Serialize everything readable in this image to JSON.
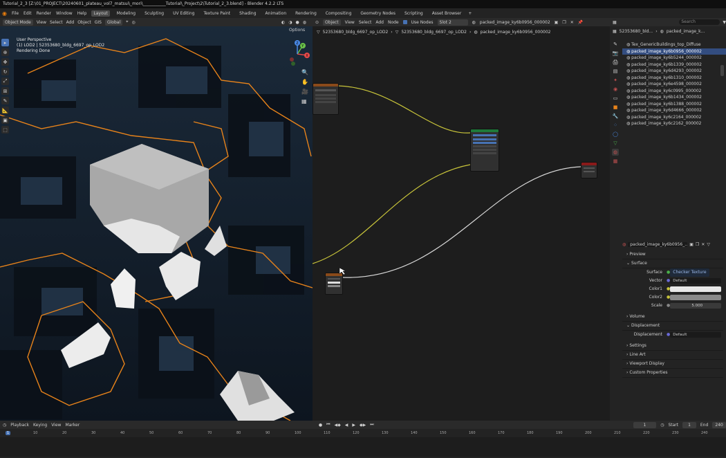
{
  "window": {
    "title": "Tutorial_2_3 [Z:\\01_PROJECT\\20240601_plateau_vol7_matsui\\_mori\\___________Tutorial\\_Project\\2\\Tutorial_2_3.blend] - Blender 4.2.2 LTS"
  },
  "menu": {
    "items": [
      "File",
      "Edit",
      "Render",
      "Window",
      "Help"
    ],
    "workspaces": [
      "Layout",
      "Modeling",
      "Sculpting",
      "UV Editing",
      "Texture Paint",
      "Shading",
      "Animation",
      "Rendering",
      "Compositing",
      "Geometry Nodes",
      "Scripting",
      "Asset Browser"
    ],
    "active_workspace": "Layout"
  },
  "viewport": {
    "mode": "Object Mode",
    "menu": [
      "View",
      "Select",
      "Add",
      "Object"
    ],
    "gis": "GIS",
    "orientation": "Global",
    "options": "Options",
    "info": {
      "line1": "User Perspective",
      "line2": "(1) LOD2 | 52353680_bldg_6697_op_LOD2",
      "line3": "Rendering Done"
    },
    "gizmo": {
      "x": "X",
      "y": "Y",
      "z": "Z"
    }
  },
  "node_editor": {
    "type": "Object",
    "menu": [
      "View",
      "Select",
      "Add",
      "Node"
    ],
    "use_nodes": "Use Nodes",
    "slot": "Slot 2",
    "material": "packed_image_ky6b0956_000002",
    "breadcrumb": [
      "52353680_bldg_6697_op_LOD2",
      "52353680_bldg_6697_op_LOD2",
      "packed_image_ky6b0956_000002"
    ]
  },
  "outliner": {
    "search_placeholder": "Search",
    "breadcrumb": [
      "52353680_bld...",
      "packed_image_k..."
    ],
    "items": [
      "Tex_GenericBuildings_top_Diffuse",
      "packed_image_ky6b0956_000002",
      "packed_image_ky6b5244_000002",
      "packed_image_ky6b1339_000002",
      "packed_image_ky6d4293_000002",
      "packed_image_ky6b1310_000002",
      "packed_image_ky6e4598_000002",
      "packed_image_ky6c0995_000002",
      "packed_image_ky6b1434_000002",
      "packed_image_ky6b1388_000002",
      "packed_image_ky6d4666_000002",
      "packed_image_ky6c2164_000002",
      "packed_image_ky6c2162_000002"
    ],
    "selected_index": 1
  },
  "properties": {
    "material_name": "packed_image_ky6b0956_...",
    "sections": {
      "preview": "Preview",
      "surface": "Surface",
      "volume": "Volume",
      "displacement": "Displacement",
      "settings": "Settings",
      "line_art": "Line Art",
      "viewport_display": "Viewport Display",
      "custom_properties": "Custom Properties"
    },
    "surface": {
      "surface_label": "Surface",
      "surface_value": "Checker Texture",
      "vector_label": "Vector",
      "vector_value": "Default",
      "color1_label": "Color1",
      "color1": "#e8e8e8",
      "color2_label": "Color2",
      "color2": "#8a8a8a",
      "scale_label": "Scale",
      "scale_value": "5.000"
    },
    "displacement": {
      "label": "Displacement",
      "value": "Default"
    }
  },
  "timeline": {
    "menu": [
      "Playback",
      "Keying",
      "View",
      "Marker"
    ],
    "current_frame": "1",
    "start_label": "Start",
    "start": "1",
    "end_label": "End",
    "end": "240",
    "ticks": [
      "1",
      "10",
      "20",
      "30",
      "40",
      "50",
      "60",
      "70",
      "80",
      "90",
      "100",
      "110",
      "120",
      "130",
      "140",
      "150",
      "160",
      "170",
      "180",
      "190",
      "200",
      "210",
      "220",
      "230",
      "240"
    ]
  }
}
